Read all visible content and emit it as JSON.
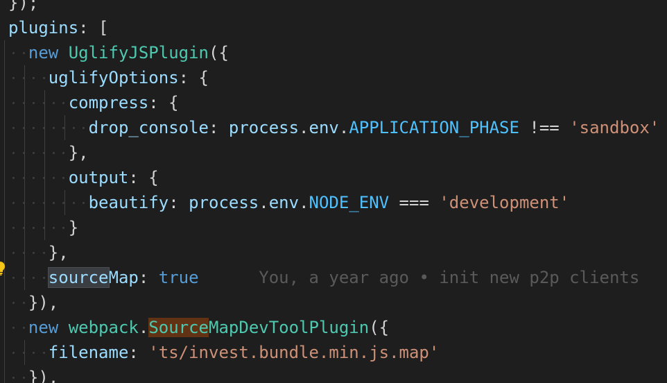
{
  "editor": {
    "lines": [
      {
        "tokens": [
          {
            "text": "});",
            "kind": "punc"
          }
        ]
      },
      {
        "tokens": [
          {
            "text": "plugins",
            "kind": "prop"
          },
          {
            "text": ": [",
            "kind": "punc"
          }
        ]
      },
      {
        "tokens": [
          {
            "text": "new",
            "kind": "kw"
          },
          {
            "text": " ",
            "kind": "punc"
          },
          {
            "text": "UglifyJSPlugin",
            "kind": "cls"
          },
          {
            "text": "({",
            "kind": "punc"
          }
        ]
      },
      {
        "tokens": [
          {
            "text": "uglifyOptions",
            "kind": "prop"
          },
          {
            "text": ": {",
            "kind": "punc"
          }
        ]
      },
      {
        "tokens": [
          {
            "text": "compress",
            "kind": "prop"
          },
          {
            "text": ": {",
            "kind": "punc"
          }
        ]
      },
      {
        "tokens": [
          {
            "text": "drop_console",
            "kind": "prop"
          },
          {
            "text": ": ",
            "kind": "punc"
          },
          {
            "text": "process",
            "kind": "prop"
          },
          {
            "text": ".",
            "kind": "punc"
          },
          {
            "text": "env",
            "kind": "prop"
          },
          {
            "text": ".",
            "kind": "punc"
          },
          {
            "text": "APPLICATION_PHASE",
            "kind": "const"
          },
          {
            "text": " !== ",
            "kind": "op"
          },
          {
            "text": "'sandbox'",
            "kind": "str"
          }
        ]
      },
      {
        "tokens": [
          {
            "text": "},",
            "kind": "punc"
          }
        ]
      },
      {
        "tokens": [
          {
            "text": "output",
            "kind": "prop"
          },
          {
            "text": ": {",
            "kind": "punc"
          }
        ]
      },
      {
        "tokens": [
          {
            "text": "beautify",
            "kind": "prop"
          },
          {
            "text": ": ",
            "kind": "punc"
          },
          {
            "text": "process",
            "kind": "prop"
          },
          {
            "text": ".",
            "kind": "punc"
          },
          {
            "text": "env",
            "kind": "prop"
          },
          {
            "text": ".",
            "kind": "punc"
          },
          {
            "text": "NODE_ENV",
            "kind": "const"
          },
          {
            "text": " === ",
            "kind": "op"
          },
          {
            "text": "'development'",
            "kind": "str"
          }
        ]
      },
      {
        "tokens": [
          {
            "text": "}",
            "kind": "punc"
          }
        ]
      },
      {
        "tokens": [
          {
            "text": "},",
            "kind": "punc"
          }
        ]
      },
      {
        "tokens": [
          {
            "text": "source",
            "kind": "prop",
            "highlight": "word"
          },
          {
            "text": "Map",
            "kind": "prop"
          },
          {
            "text": ": ",
            "kind": "punc"
          },
          {
            "text": "true",
            "kind": "kw"
          },
          {
            "text": "      You, a year ago • init new p2p clients",
            "kind": "ghost"
          }
        ]
      },
      {
        "tokens": [
          {
            "text": "}),",
            "kind": "punc"
          }
        ]
      },
      {
        "tokens": [
          {
            "text": "new",
            "kind": "kw"
          },
          {
            "text": " ",
            "kind": "punc"
          },
          {
            "text": "webpack",
            "kind": "cls"
          },
          {
            "text": ".",
            "kind": "punc"
          },
          {
            "text": "Source",
            "kind": "cls",
            "highlight": "bracket"
          },
          {
            "text": "MapDevToolPlugin",
            "kind": "cls"
          },
          {
            "text": "({",
            "kind": "punc"
          }
        ]
      },
      {
        "tokens": [
          {
            "text": "filename",
            "kind": "prop"
          },
          {
            "text": ": ",
            "kind": "punc"
          },
          {
            "text": "'ts/invest.bundle.min.js.map'",
            "kind": "str"
          }
        ]
      },
      {
        "tokens": [
          {
            "text": "}),",
            "kind": "punc"
          }
        ]
      }
    ],
    "blame": {
      "author": "You",
      "when": "a year ago",
      "message": "init new p2p clients"
    },
    "colors": {
      "background": "#1e1e1e",
      "property": "#9cdcfe",
      "keyword": "#569cd6",
      "class": "#4ec9b0",
      "string": "#ce9178",
      "constant": "#4fc1ff",
      "punctuation": "#d4d4d4",
      "ghost_text": "#5a5a5a",
      "lightbulb": "#f5c518"
    },
    "icons": {
      "lightbulb": "lightbulb-icon"
    }
  }
}
